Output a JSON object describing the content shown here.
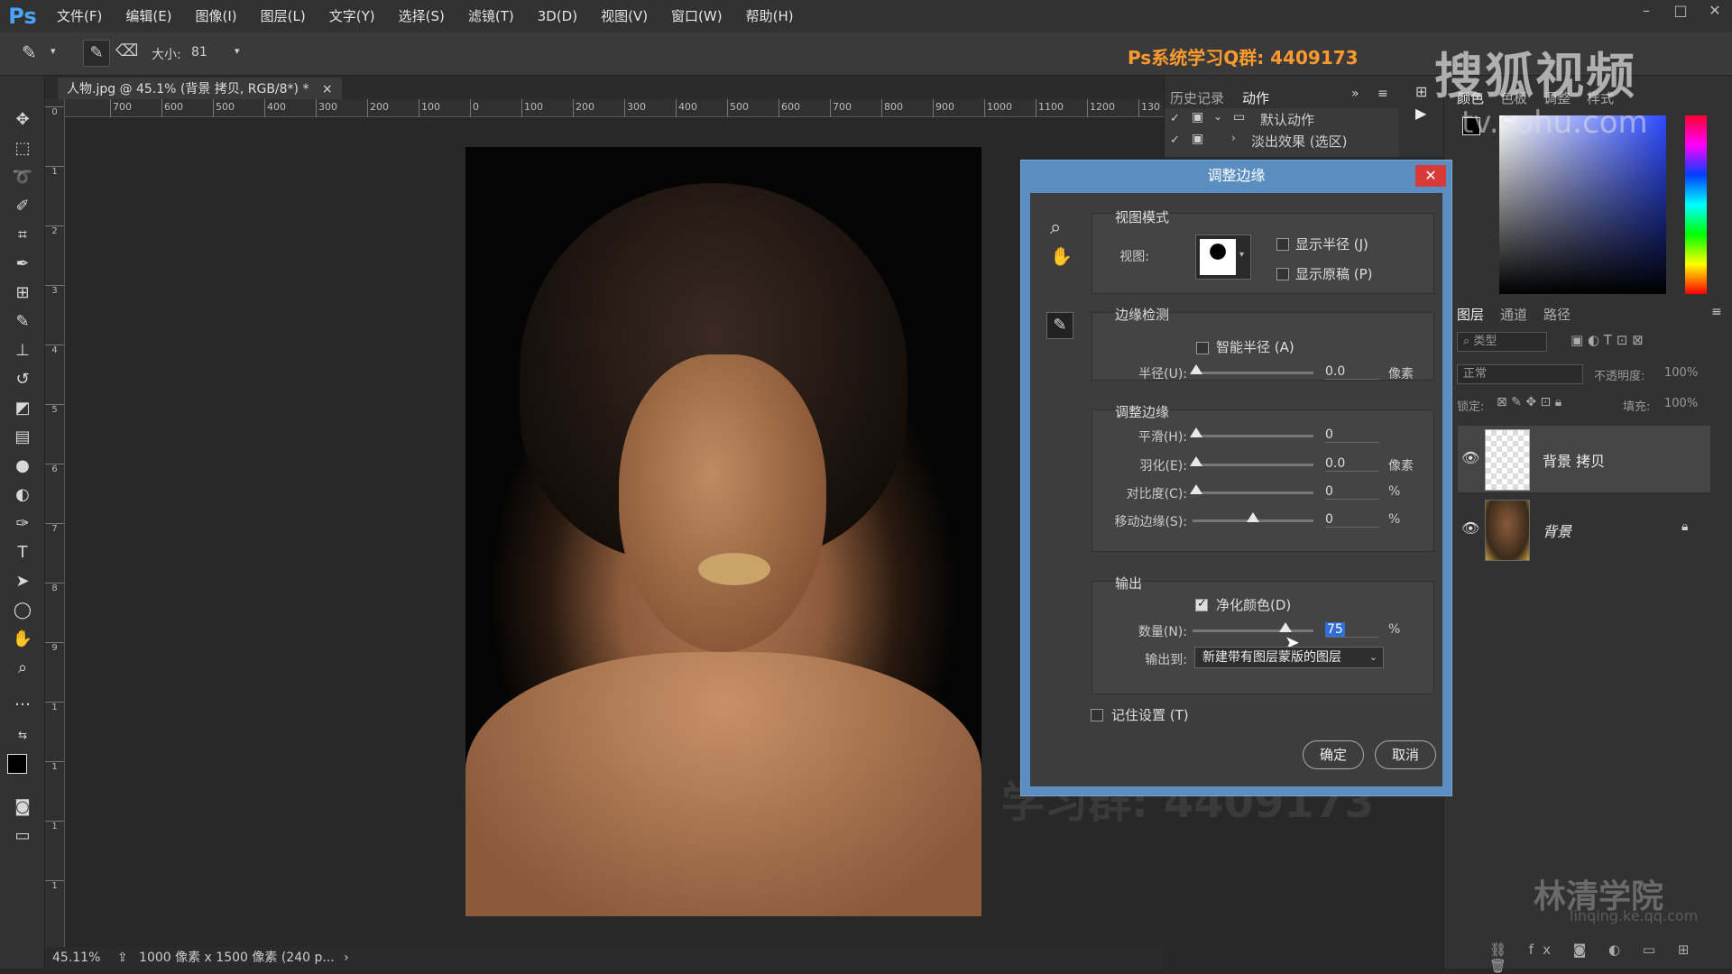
{
  "app": {
    "logo": "Ps"
  },
  "menu": [
    "文件(F)",
    "编辑(E)",
    "图像(I)",
    "图层(L)",
    "文字(Y)",
    "选择(S)",
    "滤镜(T)",
    "3D(D)",
    "视图(V)",
    "窗口(W)",
    "帮助(H)"
  ],
  "options": {
    "size_label": "大小:",
    "size_value": "81",
    "qq_group": "Ps系统学习Q群: 4409173"
  },
  "document": {
    "tab_title": "人物.jpg @ 45.1% (背景 拷贝, RGB/8*) *"
  },
  "ruler_h": [
    "700",
    "600",
    "500",
    "400",
    "300",
    "200",
    "100",
    "0",
    "100",
    "200",
    "300",
    "400",
    "500",
    "600",
    "700",
    "800",
    "900",
    "1000",
    "1100",
    "1200",
    "130"
  ],
  "ruler_v": [
    "0",
    "1",
    "2",
    "3",
    "4",
    "5",
    "6",
    "7",
    "8",
    "9",
    "1",
    "1",
    "1",
    "1"
  ],
  "status": {
    "zoom": "45.11%",
    "info": "1000 像素 x 1500 像素 (240 p..."
  },
  "actions_panel": {
    "tabs": [
      "历史记录",
      "动作"
    ],
    "items": [
      "默认动作",
      "淡出效果 (选区)"
    ]
  },
  "color_panel": {
    "tabs": [
      "颜色",
      "色板",
      "调整",
      "样式"
    ]
  },
  "layers_panel": {
    "tabs": [
      "图层",
      "通道",
      "路径"
    ],
    "filter_label": "类型",
    "blend_mode": "正常",
    "opacity_label": "不透明度:",
    "opacity_value": "100%",
    "lock_label": "锁定:",
    "fill_label": "填充:",
    "fill_value": "100%",
    "layers": [
      {
        "name": "背景 拷贝"
      },
      {
        "name": "背景"
      }
    ]
  },
  "watermarks": {
    "sohu": "搜狐视频",
    "sohu_url": "tv.sohu.com",
    "lq": "林清学院",
    "lq_url": "linqing.ke.qq.com",
    "group": "学习群: 4409173"
  },
  "dialog": {
    "title": "调整边缘",
    "view_mode": {
      "title": "视图模式",
      "view_label": "视图:",
      "show_radius": "显示半径 (J)",
      "show_original": "显示原稿 (P)"
    },
    "edge_detection": {
      "title": "边缘检测",
      "smart_radius": "智能半径 (A)",
      "radius_label": "半径(U):",
      "radius_value": "0.0",
      "radius_unit": "像素"
    },
    "adjust_edge": {
      "title": "调整边缘",
      "smooth_label": "平滑(H):",
      "smooth_value": "0",
      "feather_label": "羽化(E):",
      "feather_value": "0.0",
      "feather_unit": "像素",
      "contrast_label": "对比度(C):",
      "contrast_value": "0",
      "contrast_unit": "%",
      "shift_label": "移动边缘(S):",
      "shift_value": "0",
      "shift_unit": "%"
    },
    "output": {
      "title": "输出",
      "decontaminate": "净化颜色(D)",
      "amount_label": "数量(N):",
      "amount_value": "75",
      "amount_unit": "%",
      "output_to_label": "输出到:",
      "output_to_value": "新建带有图层蒙版的图层"
    },
    "remember": "记住设置 (T)",
    "ok": "确定",
    "cancel": "取消"
  }
}
